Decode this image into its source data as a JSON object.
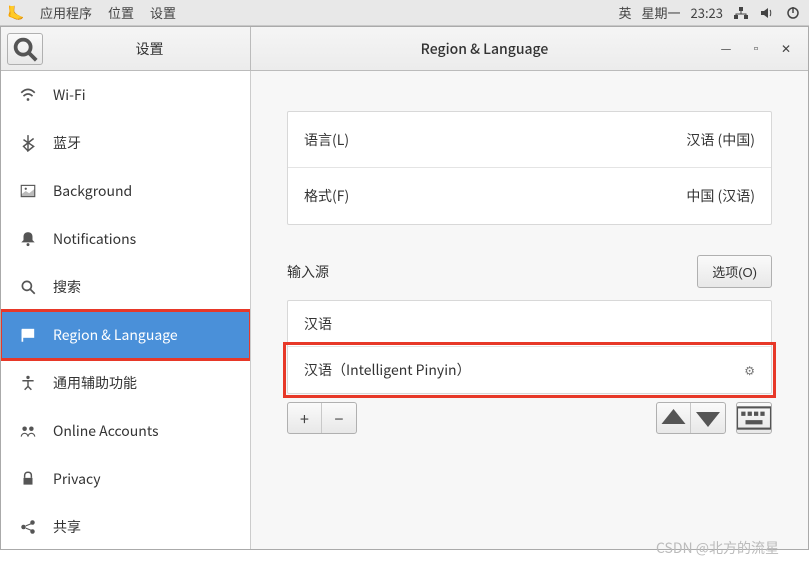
{
  "topbar": {
    "apps": "应用程序",
    "places": "位置",
    "settings": "设置",
    "ime": "英",
    "day": "星期一",
    "time": "23:23"
  },
  "window": {
    "sidebar_title": "设置",
    "content_title": "Region & Language"
  },
  "sidebar": {
    "items": [
      {
        "label": "Wi-Fi",
        "icon": "wifi"
      },
      {
        "label": "蓝牙",
        "icon": "bluetooth"
      },
      {
        "label": "Background",
        "icon": "background"
      },
      {
        "label": "Notifications",
        "icon": "bell"
      },
      {
        "label": "搜索",
        "icon": "search"
      },
      {
        "label": "Region & Language",
        "icon": "flag",
        "selected": true
      },
      {
        "label": "通用辅助功能",
        "icon": "accessibility"
      },
      {
        "label": "Online Accounts",
        "icon": "accounts"
      },
      {
        "label": "Privacy",
        "icon": "privacy"
      },
      {
        "label": "共享",
        "icon": "share"
      }
    ]
  },
  "region": {
    "language_label": "语言(L)",
    "language_value": "汉语 (中国)",
    "formats_label": "格式(F)",
    "formats_value": "中国 (汉语)",
    "input_sources_title": "输入源",
    "options_btn": "选项(O)",
    "sources": [
      {
        "label": "汉语"
      },
      {
        "label": "汉语（Intelligent Pinyin）",
        "has_settings": true
      }
    ]
  },
  "watermark": "CSDN @北方的流星"
}
